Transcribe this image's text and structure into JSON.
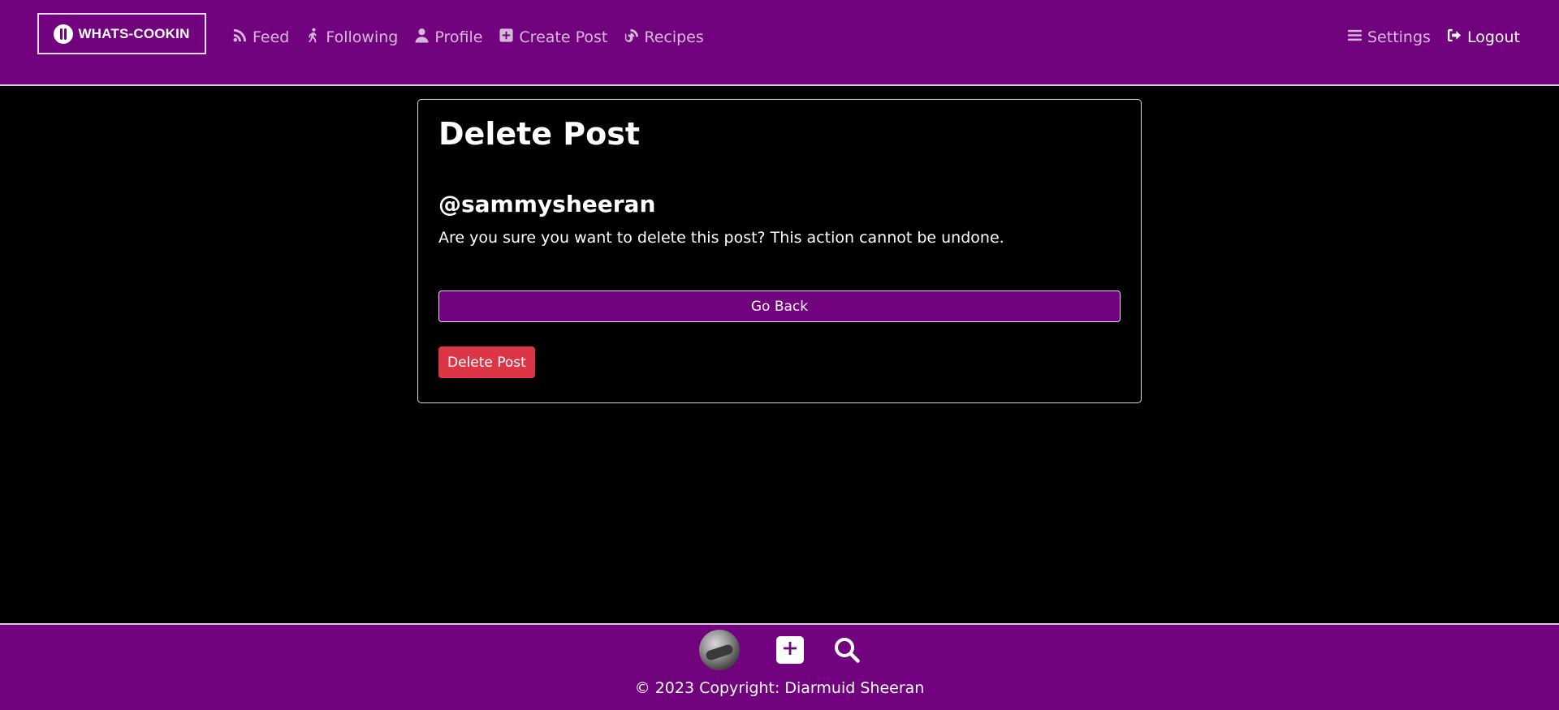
{
  "brand": {
    "name": "WHATS-COOKIN"
  },
  "nav": {
    "items": [
      {
        "label": "Feed",
        "icon": "rss-icon"
      },
      {
        "label": "Following",
        "icon": "walking-person-icon"
      },
      {
        "label": "Profile",
        "icon": "user-icon"
      },
      {
        "label": "Create Post",
        "icon": "plus-square-icon"
      },
      {
        "label": "Recipes",
        "icon": "blog-icon"
      }
    ],
    "right": [
      {
        "label": "Settings",
        "icon": "bars-icon"
      },
      {
        "label": "Logout",
        "icon": "logout-icon"
      }
    ]
  },
  "card": {
    "title": "Delete Post",
    "username": "@sammysheeran",
    "message": "Are you sure you want to delete this post? This action cannot be undone.",
    "back_label": "Go Back",
    "delete_label": "Delete Post"
  },
  "footer": {
    "copyright": "© 2023 Copyright: Diarmuid Sheeran"
  },
  "colors": {
    "brand_purple": "#71037e",
    "danger_red": "#dc3545",
    "background": "#000000"
  }
}
